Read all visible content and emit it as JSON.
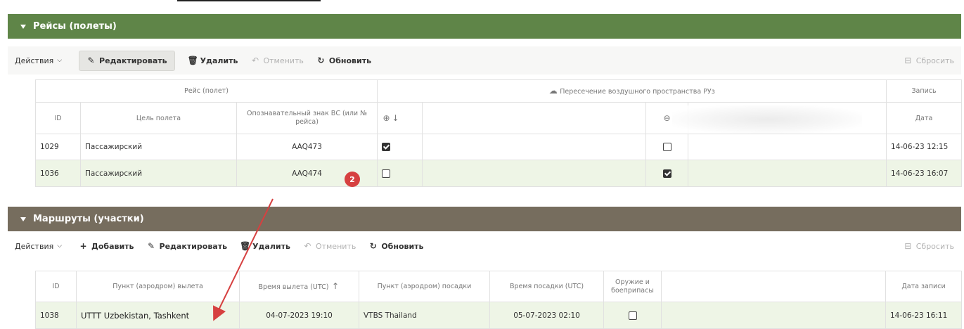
{
  "flights_panel": {
    "title": "Рейсы (полеты)",
    "toolbar": {
      "actions": "Действия",
      "edit": "Редактировать",
      "delete": "Удалить",
      "undo": "Отменить",
      "refresh": "Обновить",
      "reset": "Сбросить"
    },
    "group_headers": {
      "flight": "Рейс (полет)",
      "crossing": "Пересечение воздушного пространства РУз",
      "record": "Запись"
    },
    "columns": {
      "id": "ID",
      "purpose": "Цель полета",
      "callsign": "Опознавательный знак ВС (или № рейса)",
      "date": "Дата"
    },
    "rows": [
      {
        "id": "1029",
        "purpose": "Пассажирский",
        "callsign": "AAQ473",
        "enter": true,
        "exit": false,
        "date": "14-06-23 12:15"
      },
      {
        "id": "1036",
        "purpose": "Пассажирский",
        "callsign": "AAQ474",
        "enter": false,
        "exit": true,
        "date": "14-06-23 16:07"
      }
    ]
  },
  "routes_panel": {
    "title": "Маршруты (участки)",
    "toolbar": {
      "actions": "Действия",
      "add": "Добавить",
      "edit": "Редактировать",
      "delete": "Удалить",
      "undo": "Отменить",
      "refresh": "Обновить",
      "reset": "Сбросить"
    },
    "columns": {
      "id": "ID",
      "departure_point": "Пункт (аэродром) вылета",
      "departure_time": "Время вылета (UTC)",
      "arrival_point": "Пункт (аэродром) посадки",
      "arrival_time": "Время посадки (UTC)",
      "weapons": "Оружие и боеприпасы",
      "record_date": "Дата записи"
    },
    "rows": [
      {
        "id": "1038",
        "departure_point": "UTTT Uzbekistan, Tashkent",
        "departure_time": "04-07-2023 19:10",
        "arrival_point": "VTBS Thailand",
        "arrival_time": "05-07-2023 02:10",
        "weapons": false,
        "record_date": "14-06-23 16:11"
      }
    ]
  },
  "annotation": {
    "badge": "2",
    "color": "#d64040"
  },
  "colors": {
    "flights_header": "#5f8548",
    "routes_header": "#766d5e",
    "selected_row": "#eef5e6"
  }
}
